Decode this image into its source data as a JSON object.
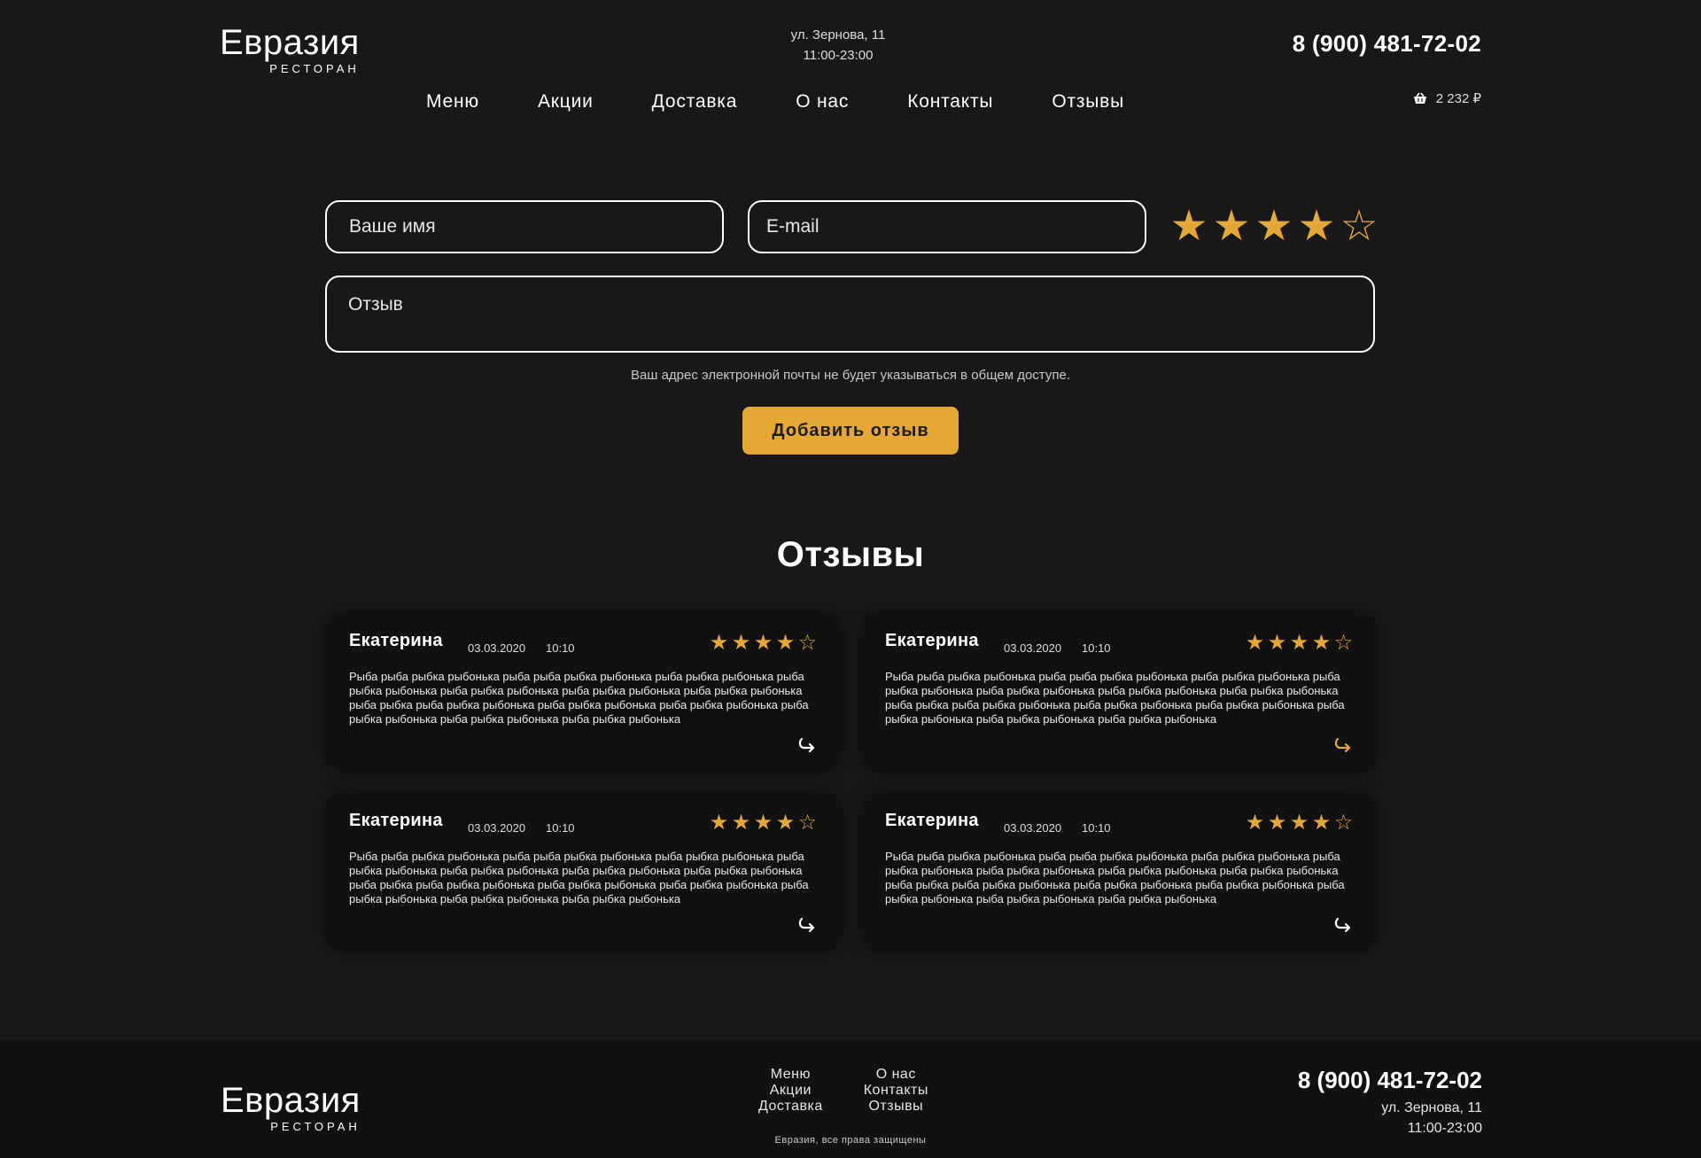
{
  "header": {
    "logo_name": "Евразия",
    "logo_sub": "РЕСТОРАН",
    "address": "ул. Зернова, 11",
    "hours": "11:00-23:00",
    "phone": "8 (900) 481-72-02",
    "nav": [
      "Меню",
      "Акции",
      "Доставка",
      "О нас",
      "Контакты",
      "Отзывы"
    ],
    "cart_total": "2 232 ₽",
    "cart_icon": "basket-icon"
  },
  "form": {
    "name_placeholder": "Ваше имя",
    "email_placeholder": "E-mail",
    "review_placeholder": "Отзыв",
    "rating": 4,
    "rating_max": 5,
    "privacy_note": "Ваш адрес электронной почты не будет указываться в общем доступе.",
    "submit_label": "Добавить отзыв"
  },
  "reviews": {
    "title": "Отзывы",
    "items": [
      {
        "author": "Екатерина",
        "date": "03.03.2020",
        "time": "10:10",
        "rating": 4,
        "text": "Рыба рыба рыбка рыбонька рыба рыба рыбка рыбонька рыба рыбка рыбонька рыба рыбка рыбонька рыба рыбка рыбонька рыба рыбка рыбонька рыба рыбка рыбонька рыба рыбка рыба рыбка рыбонька рыба рыбка рыбонька рыба рыбка рыбонька рыба рыбка рыбонька рыба рыбка рыбонька рыба рыбка рыбонька",
        "reply_highlighted": false
      },
      {
        "author": "Екатерина",
        "date": "03.03.2020",
        "time": "10:10",
        "rating": 4,
        "text": "Рыба рыба рыбка рыбонька рыба рыба рыбка рыбонька рыба рыбка рыбонька рыба рыбка рыбонька рыба рыбка рыбонька рыба рыбка рыбонька рыба рыбка рыбонька рыба рыбка рыба рыбка рыбонька рыба рыбка рыбонька рыба рыбка рыбонька рыба рыбка рыбонька рыба рыбка рыбонька рыба рыбка рыбонька",
        "reply_highlighted": true
      },
      {
        "author": "Екатерина",
        "date": "03.03.2020",
        "time": "10:10",
        "rating": 4,
        "text": "Рыба рыба рыбка рыбонька рыба рыба рыбка рыбонька рыба рыбка рыбонька рыба рыбка рыбонька рыба рыбка рыбонька рыба рыбка рыбонька рыба рыбка рыбонька рыба рыбка рыба рыбка рыбонька рыба рыбка рыбонька рыба рыбка рыбонька рыба рыбка рыбонька рыба рыбка рыбонька рыба рыбка рыбонька",
        "reply_highlighted": false
      },
      {
        "author": "Екатерина",
        "date": "03.03.2020",
        "time": "10:10",
        "rating": 4,
        "text": "Рыба рыба рыбка рыбонька рыба рыба рыбка рыбонька рыба рыбка рыбонька рыба рыбка рыбонька рыба рыбка рыбонька рыба рыбка рыбонька рыба рыбка рыбонька рыба рыбка рыба рыбка рыбонька рыба рыбка рыбонька рыба рыбка рыбонька рыба рыбка рыбонька рыба рыбка рыбонька рыба рыбка рыбонька",
        "reply_highlighted": false
      }
    ],
    "reply_icon": "reply-arrow-icon"
  },
  "footer": {
    "logo_name": "Евразия",
    "logo_sub": "РЕСТОРАН",
    "links_col1": [
      "Меню",
      "Акции",
      "Доставка"
    ],
    "links_col2": [
      "О нас",
      "Контакты",
      "Отзывы"
    ],
    "copyright": "Евразия, все права защищены",
    "phone": "8 (900) 481-72-02",
    "address": "ул. Зернова, 11",
    "hours": "11:00-23:00"
  },
  "colors": {
    "background": "#181818",
    "accent": "#e5a835",
    "card": "#111111",
    "text": "#ffffff"
  }
}
